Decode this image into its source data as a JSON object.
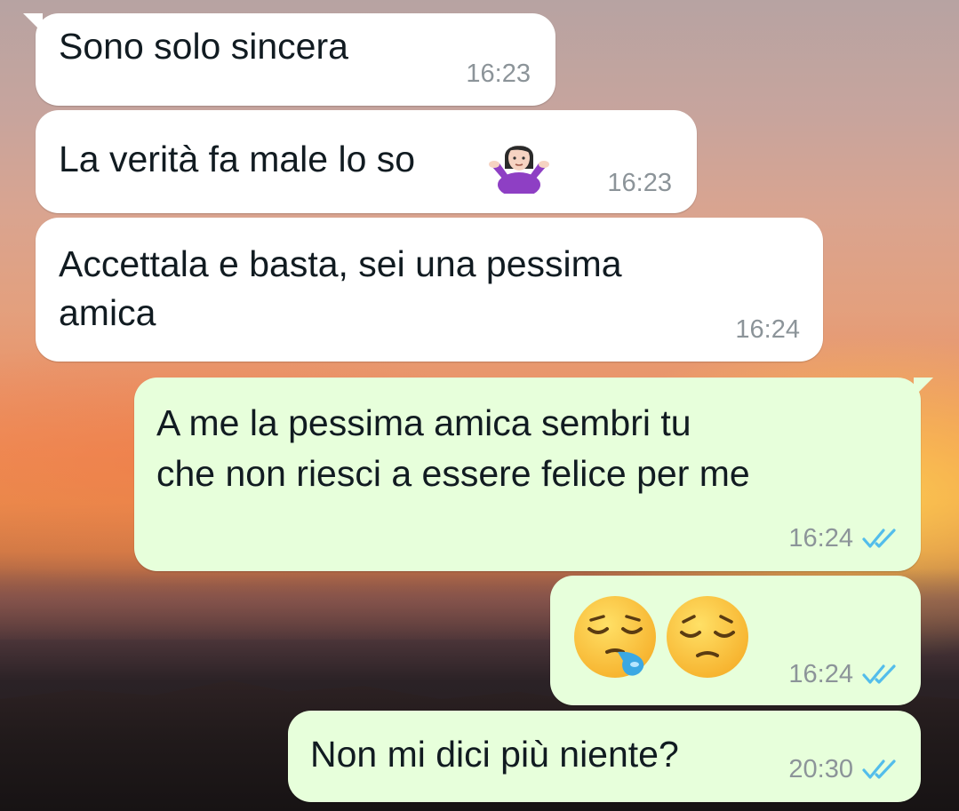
{
  "chat": {
    "messages": [
      {
        "direction": "incoming",
        "text": "Sono solo sincera",
        "time": "16:23"
      },
      {
        "direction": "incoming",
        "text": "La verità fa male lo so",
        "emoji": "person-shrugging",
        "time": "16:23"
      },
      {
        "direction": "incoming",
        "text_line1": "Accettala e basta, sei una pessima",
        "text_line2": "amica",
        "time": "16:24"
      },
      {
        "direction": "outgoing",
        "text_line1": "A me la pessima amica sembri tu",
        "text_line2": "che non riesci a essere felice per me",
        "time": "16:24",
        "status": "read"
      },
      {
        "direction": "outgoing",
        "emojis": [
          "sleepy-face",
          "pensive-face"
        ],
        "time": "16:24",
        "status": "read"
      },
      {
        "direction": "outgoing",
        "text": "Non mi dici più niente?",
        "time": "20:30",
        "status": "read"
      }
    ]
  },
  "colors": {
    "incoming_bubble": "#ffffff",
    "outgoing_bubble": "#e7ffdb",
    "text": "#111b21",
    "meta": "#8c9499",
    "read_ticks": "#53bdeb"
  }
}
